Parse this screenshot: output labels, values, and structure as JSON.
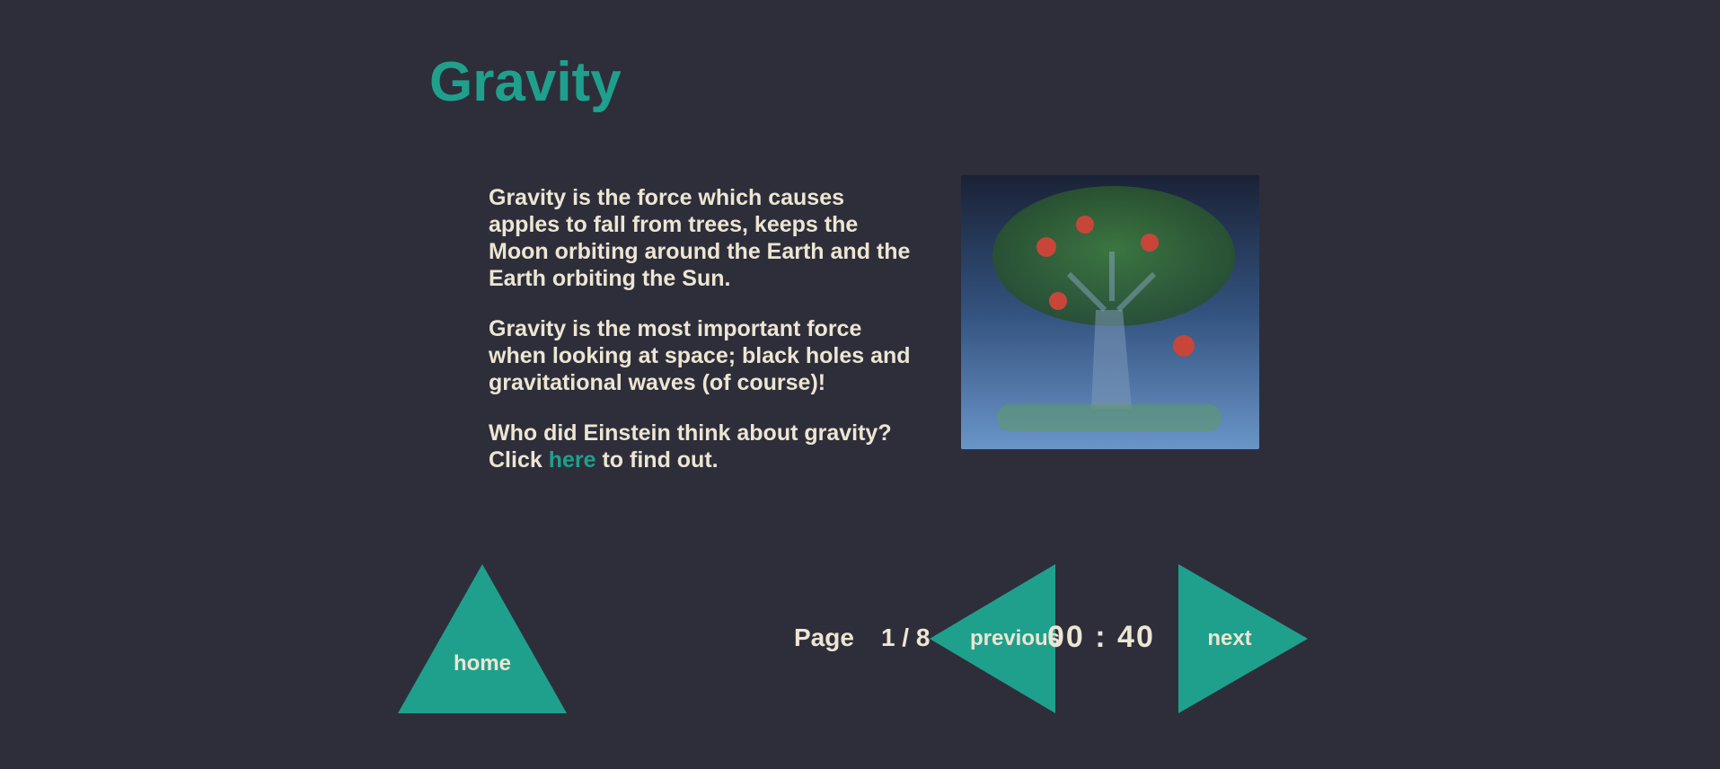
{
  "page": {
    "title": "Gravity"
  },
  "content": {
    "paragraphs": [
      "Gravity is the force which causes apples to fall from trees, keeps the Moon orbiting around the Earth and the Earth orbiting the Sun.",
      "Gravity is the most important force when looking at space; black holes and gravitational waves (of course)!"
    ],
    "question": {
      "text": "Who did Einstein think about gravity?",
      "prefix": "Click",
      "link_label": "here",
      "suffix": "to find out."
    }
  },
  "image": {
    "subject": "apple-tree-illustration"
  },
  "navigation": {
    "home_label": "home",
    "prev_label": "previous",
    "next_label": "next",
    "page_label": "Page",
    "page_value": "1 / 8",
    "timer": "00 : 40"
  },
  "colors": {
    "background": "#2e2e3b",
    "accent": "#1fa08c",
    "text": "#ece6d2"
  }
}
